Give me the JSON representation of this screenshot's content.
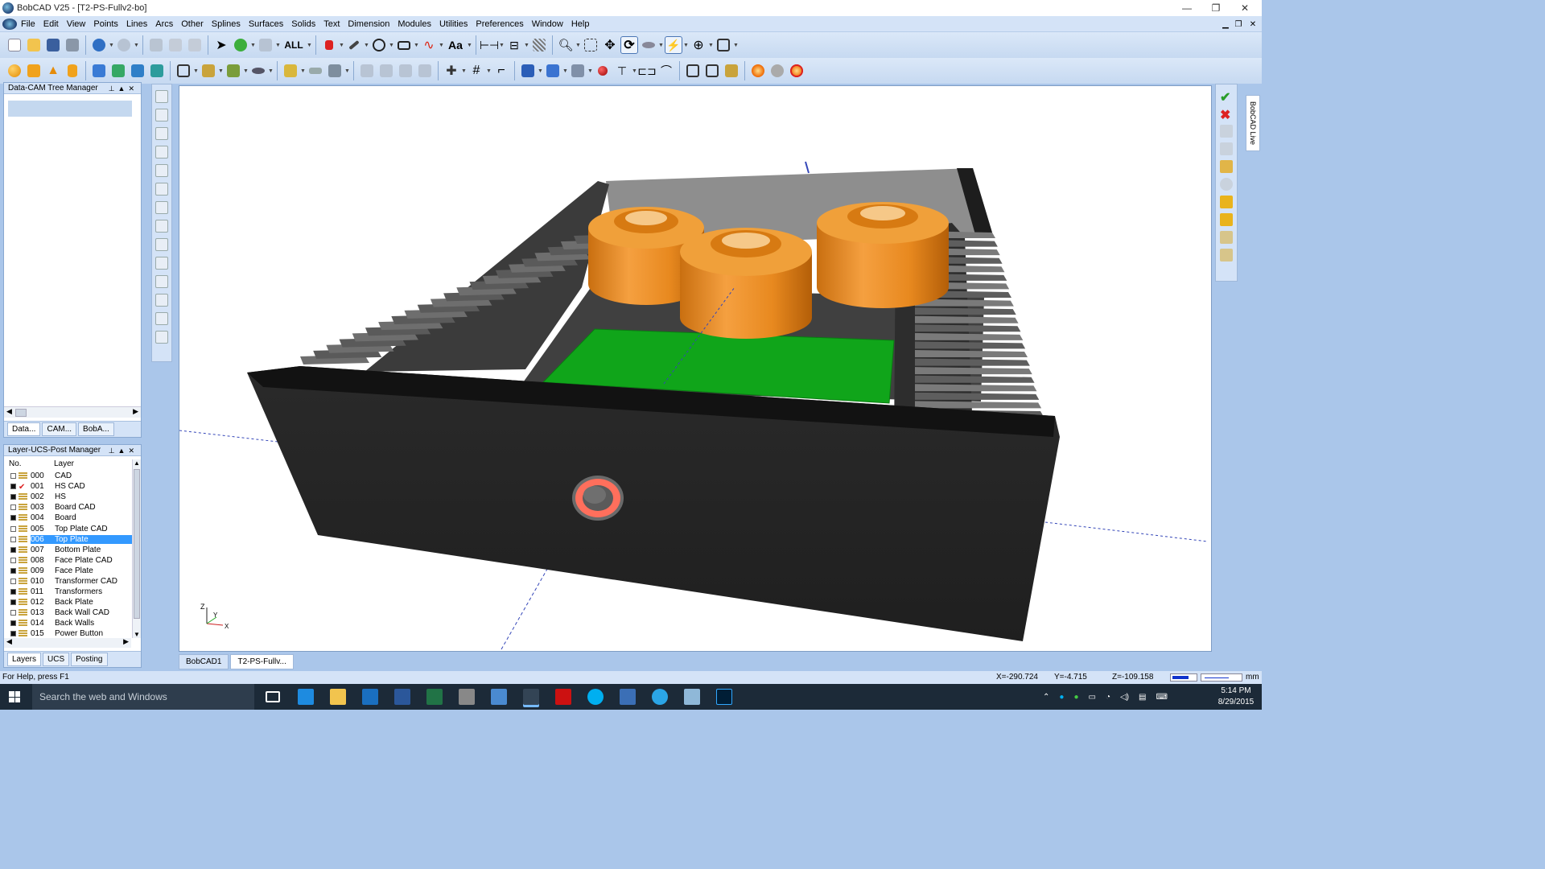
{
  "window": {
    "title": "BobCAD V25 - [T2-PS-Fullv2-bo]",
    "min": "—",
    "max": "❐",
    "close": "✕"
  },
  "menu": [
    "File",
    "Edit",
    "View",
    "Points",
    "Lines",
    "Arcs",
    "Other",
    "Splines",
    "Surfaces",
    "Solids",
    "Text",
    "Dimension",
    "Modules",
    "Utilities",
    "Preferences",
    "Window",
    "Help"
  ],
  "toolbar1": {
    "all_label": "ALL",
    "text_label": "Aa"
  },
  "tree_panel": {
    "title": "Data-CAM Tree Manager",
    "tabs": [
      "Data...",
      "CAM...",
      "BobA..."
    ]
  },
  "layer_panel": {
    "title": "Layer-UCS-Post Manager",
    "col_no": "No.",
    "col_layer": "Layer",
    "rows": [
      {
        "no": "000",
        "name": "CAD",
        "on": false,
        "current": false
      },
      {
        "no": "001",
        "name": "HS CAD",
        "on": true,
        "current": true
      },
      {
        "no": "002",
        "name": "HS",
        "on": true,
        "current": false
      },
      {
        "no": "003",
        "name": "Board CAD",
        "on": false,
        "current": false
      },
      {
        "no": "004",
        "name": "Board",
        "on": true,
        "current": false
      },
      {
        "no": "005",
        "name": "Top Plate CAD",
        "on": false,
        "current": false
      },
      {
        "no": "006",
        "name": "Top Plate",
        "on": false,
        "current": false,
        "selected": true
      },
      {
        "no": "007",
        "name": "Bottom Plate",
        "on": true,
        "current": false
      },
      {
        "no": "008",
        "name": "Face Plate CAD",
        "on": false,
        "current": false
      },
      {
        "no": "009",
        "name": "Face Plate",
        "on": true,
        "current": false
      },
      {
        "no": "010",
        "name": "Transformer CAD",
        "on": false,
        "current": false
      },
      {
        "no": "011",
        "name": "Transformers",
        "on": true,
        "current": false
      },
      {
        "no": "012",
        "name": "Back Plate",
        "on": true,
        "current": false
      },
      {
        "no": "013",
        "name": "Back Wall CAD",
        "on": false,
        "current": false
      },
      {
        "no": "014",
        "name": "Back Walls",
        "on": true,
        "current": false
      },
      {
        "no": "015",
        "name": "Power Button",
        "on": true,
        "current": false
      }
    ],
    "tabs": [
      "Layers",
      "UCS",
      "Posting"
    ]
  },
  "doc_tabs": [
    "BobCAD1",
    "T2-PS-Fullv..."
  ],
  "bobcad_live": "BobCAD Live",
  "status": {
    "help": "For Help, press F1",
    "x": "X=-290.724",
    "y": "Y=-4.715",
    "z": "Z=-109.158",
    "units": "mm"
  },
  "taskbar": {
    "search_placeholder": "Search the web and Windows",
    "time": "5:14 PM",
    "date": "8/29/2015"
  },
  "axis_labels": {
    "z": "Z",
    "y": "Y",
    "x": "X"
  },
  "colors": {
    "accent": "#3399ff",
    "chassis": "#2b2b2b",
    "transformer": "#e8891f",
    "board": "#11a51a",
    "button_ring": "#ff6f5c"
  }
}
